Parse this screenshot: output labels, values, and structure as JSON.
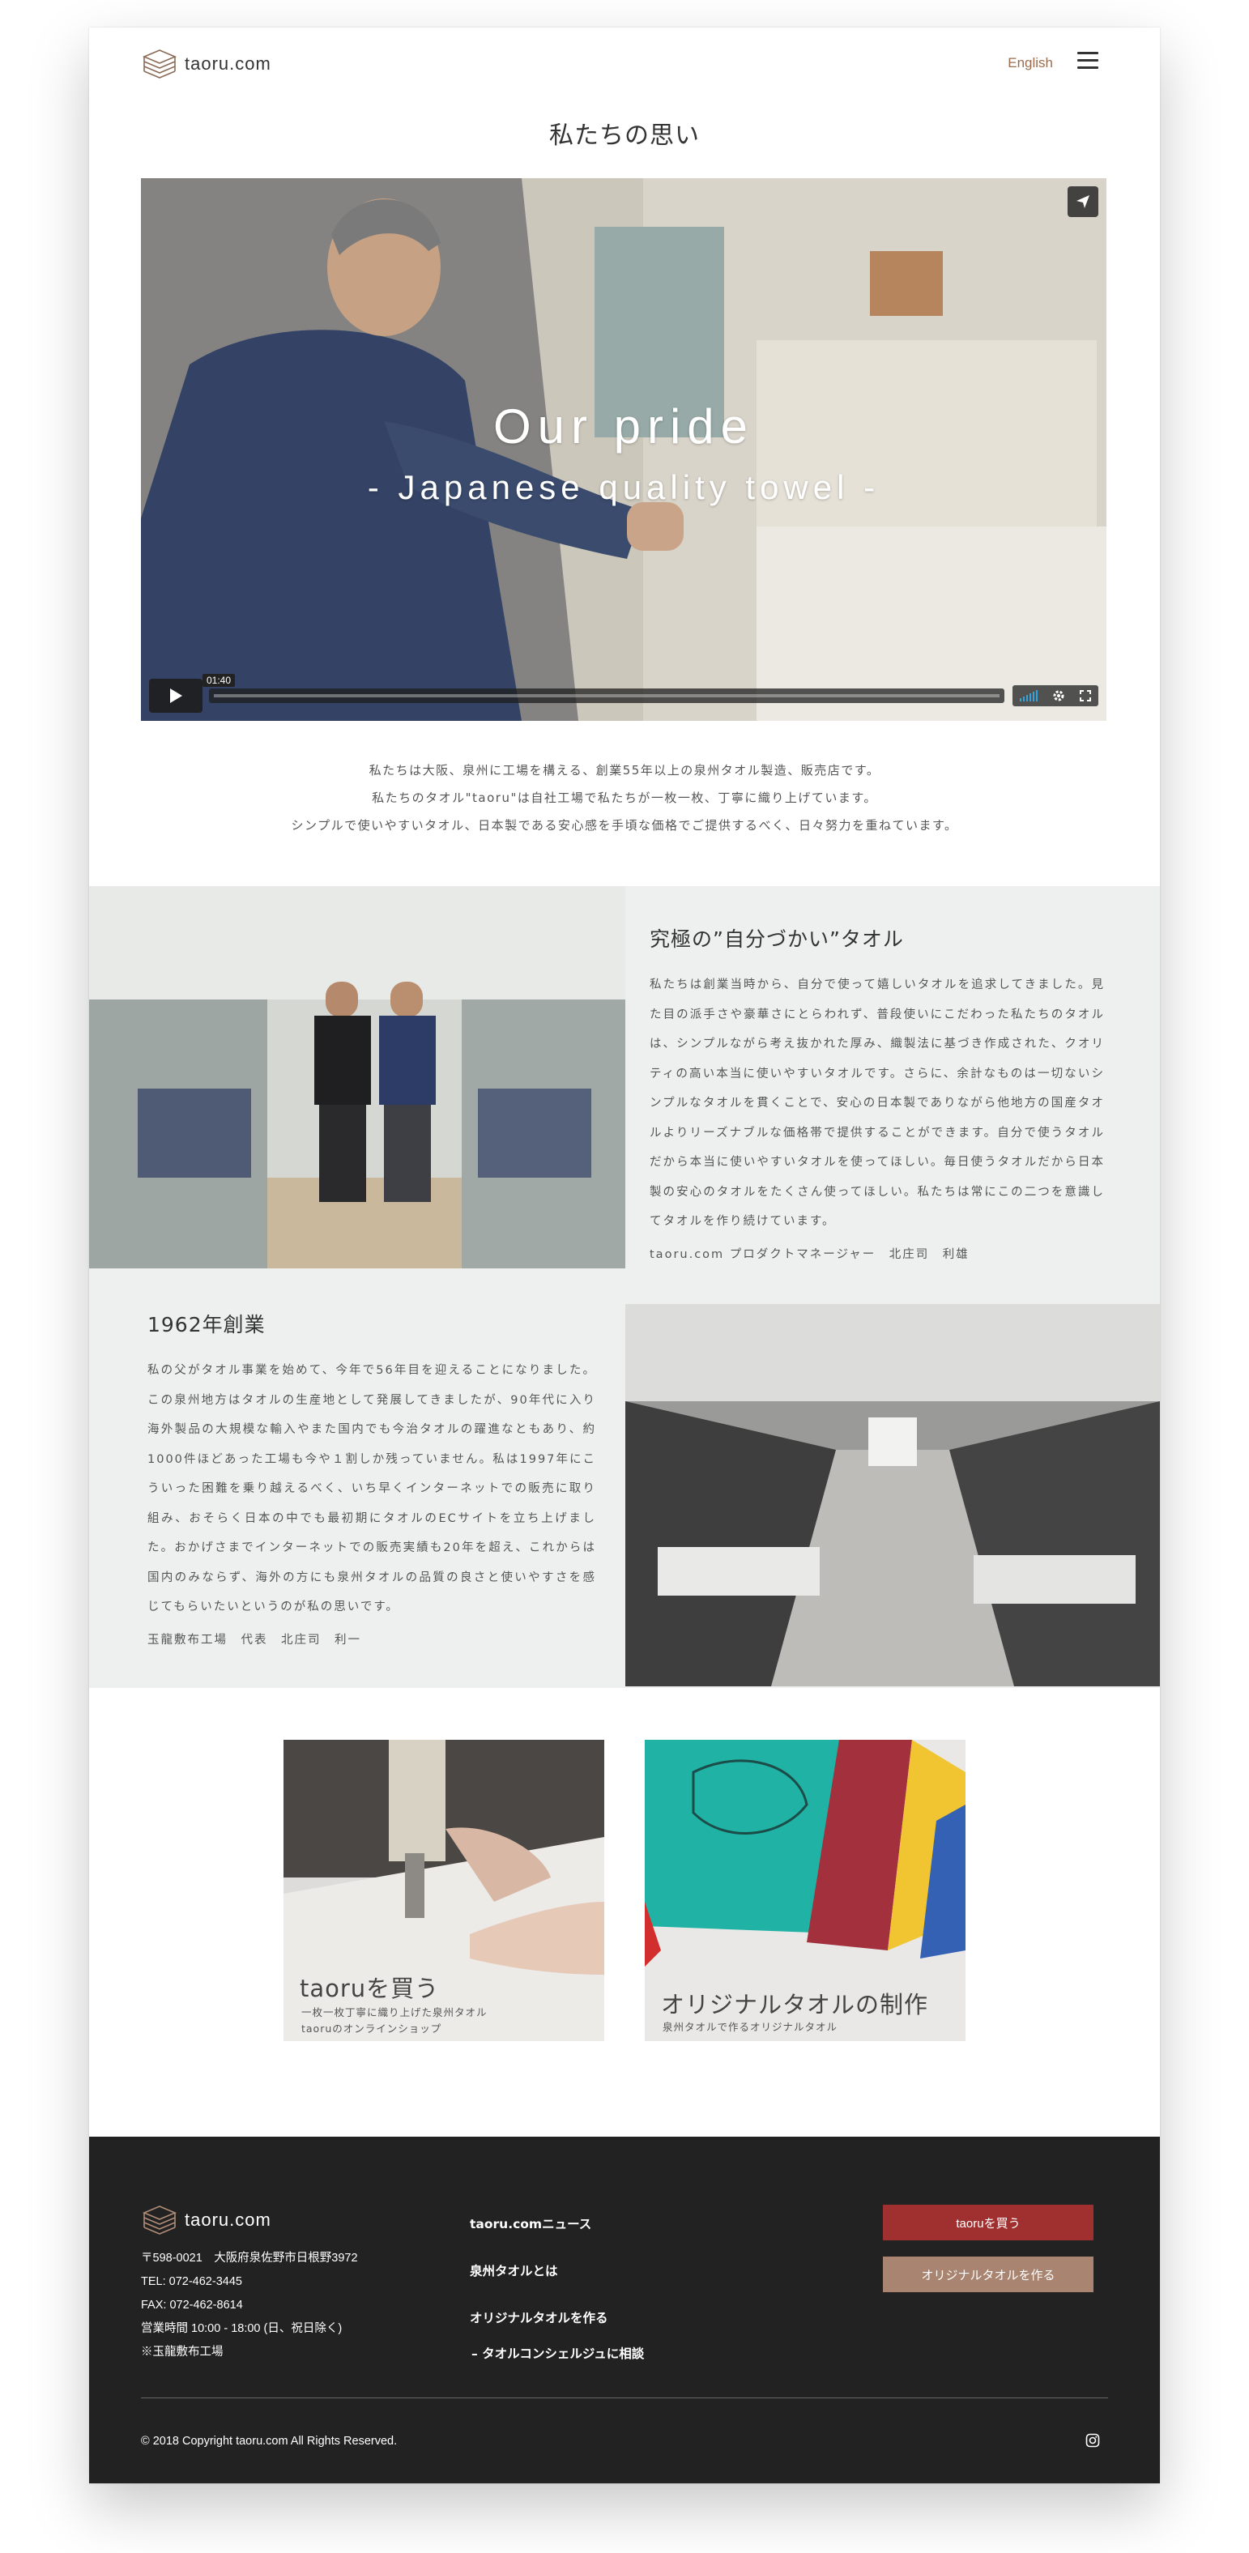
{
  "header": {
    "logo_text": "taoru.com",
    "lang_link": "English",
    "page_title": "私たちの思い"
  },
  "video": {
    "title_line1": "Our pride",
    "title_line2": "- Japanese quality towel -",
    "time": "01:40"
  },
  "intro": {
    "lines": [
      "私たちは大阪、泉州に工場を構える、創業55年以上の泉州タオル製造、販売店です。",
      "私たちのタオル\"taoru\"は自社工場で私たちが一枚一枚、丁寧に織り上げています。",
      "シンプルで使いやすいタオル、日本製である安心感を手頃な価格でご提供するべく、日々努力を重ねています。"
    ]
  },
  "section1": {
    "title": "究極の”自分づかい”タオル",
    "body": "私たちは創業当時から、自分で使って嬉しいタオルを追求してきました。見た目の派手さや豪華さにとらわれず、普段使いにこだわった私たちのタオルは、シンプルながら考え抜かれた厚み、織製法に基づき作成された、クオリティの高い本当に使いやすいタオルです。さらに、余計なものは一切ないシンプルなタオルを貫くことで、安心の日本製でありながら他地方の国産タオルよりリーズナブルな価格帯で提供することができます。自分で使うタオルだから本当に使いやすいタオルを使ってほしい。毎日使うタオルだから日本製の安心のタオルをたくさん使ってほしい。私たちは常にこの二つを意識してタオルを作り続けています。",
    "signature": "taoru.com プロダクトマネージャー　北庄司　利雄"
  },
  "section2": {
    "title": "1962年創業",
    "body": "私の父がタオル事業を始めて、今年で56年目を迎えることになりました。この泉州地方はタオルの生産地として発展してきましたが、90年代に入り海外製品の大規模な輸入やまた国内でも今治タオルの躍進なともあり、約1000件ほどあった工場も今や１割しか残っていません。私は1997年にこういった困難を乗り越えるべく、いち早くインターネットでの販売に取り組み、おそらく日本の中でも最初期にタオルのECサイトを立ち上げました。おかげさまでインターネットでの販売実績も20年を超え、これからは国内のみならず、海外の方にも泉州タオルの品質の良さと使いやすさを感じてもらいたいというのが私の思いです。",
    "signature": "玉龍敷布工場　代表　北庄司　利一"
  },
  "cards": [
    {
      "title": "taoruを買う",
      "sub1": "一枚一枚丁寧に織り上げた泉州タオル",
      "sub2": "taoruのオンラインショップ"
    },
    {
      "title": "オリジナルタオルの制作",
      "sub1": "泉州タオルで作るオリジナルタオル",
      "sub2": ""
    }
  ],
  "footer": {
    "logo_text": "taoru.com",
    "address": [
      "〒598-0021　大阪府泉佐野市日根野3972",
      "TEL: 072-462-3445",
      "FAX: 072-462-8614",
      "営業時間 10:00 - 18:00 (日、祝日除く)",
      "※玉龍敷布工場"
    ],
    "nav": [
      "taoru.comニュース",
      "泉州タオルとは",
      "オリジナルタオルを作る",
      "– タオルコンシェルジュに相談"
    ],
    "btn_buy": "taoruを買う",
    "btn_make": "オリジナルタオルを作る",
    "copyright": "© 2018 Copyright taoru.com All Rights Reserved."
  },
  "colors": {
    "accent_red": "#a0302f",
    "accent_brown": "#a98470",
    "lang_link": "#9a6d4f",
    "footer_bg": "#222222",
    "section_bg": "#eef0ef"
  },
  "icons": [
    "logo-mark-icon",
    "menu-icon",
    "share-icon",
    "play-icon",
    "volume-icon",
    "settings-icon",
    "fullscreen-icon",
    "instagram-icon"
  ]
}
